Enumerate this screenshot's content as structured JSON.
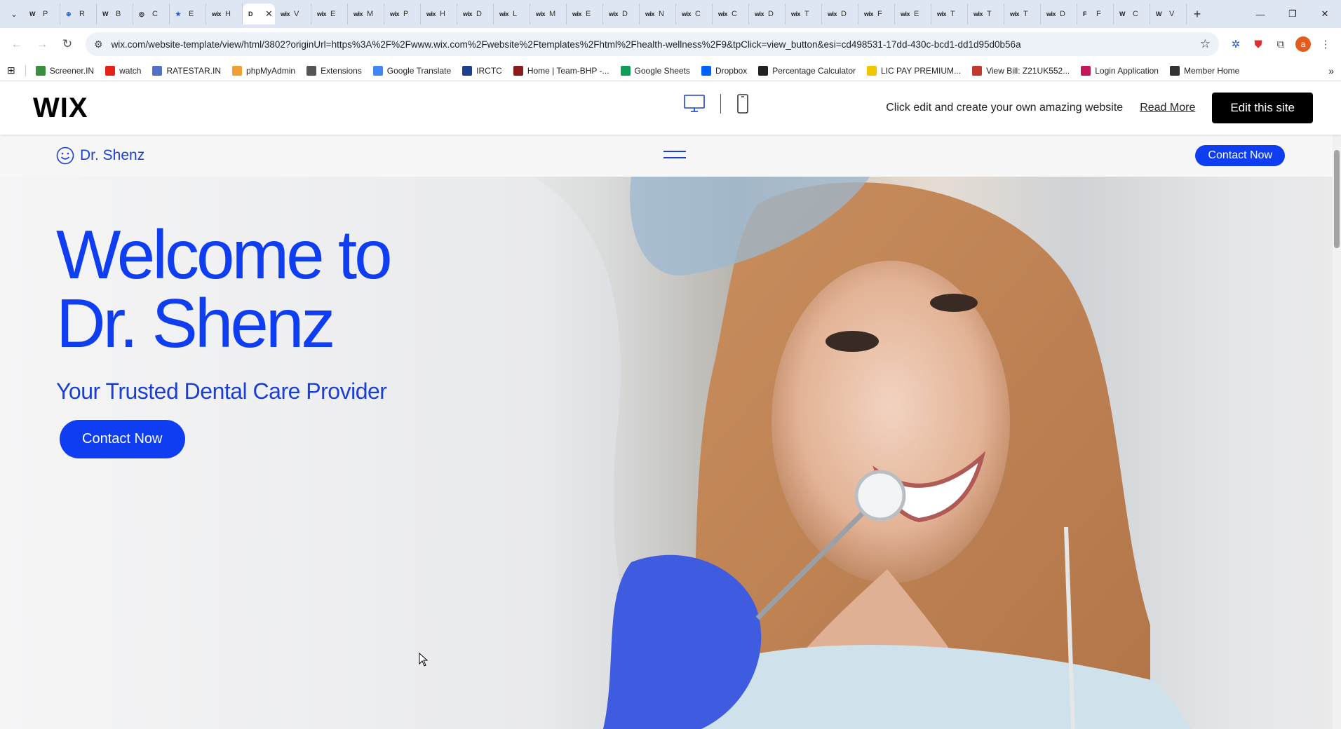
{
  "browser": {
    "tabs": [
      {
        "fav": "W",
        "label": "P"
      },
      {
        "fav": "⊕",
        "label": "R"
      },
      {
        "fav": "W",
        "label": "B"
      },
      {
        "fav": "◎",
        "label": "C"
      },
      {
        "fav": "★",
        "label": "E"
      },
      {
        "fav": "wix",
        "label": "H"
      },
      {
        "fav": "D",
        "label": "",
        "active": true
      },
      {
        "fav": "wix",
        "label": "V"
      },
      {
        "fav": "wix",
        "label": "E"
      },
      {
        "fav": "wix",
        "label": "M"
      },
      {
        "fav": "wix",
        "label": "P"
      },
      {
        "fav": "wix",
        "label": "H"
      },
      {
        "fav": "wix",
        "label": "D"
      },
      {
        "fav": "wix",
        "label": "L"
      },
      {
        "fav": "wix",
        "label": "M"
      },
      {
        "fav": "wix",
        "label": "E"
      },
      {
        "fav": "wix",
        "label": "D"
      },
      {
        "fav": "wix",
        "label": "N"
      },
      {
        "fav": "wix",
        "label": "C"
      },
      {
        "fav": "wix",
        "label": "C"
      },
      {
        "fav": "wix",
        "label": "D"
      },
      {
        "fav": "wix",
        "label": "T"
      },
      {
        "fav": "wix",
        "label": "D"
      },
      {
        "fav": "wix",
        "label": "F"
      },
      {
        "fav": "wix",
        "label": "E"
      },
      {
        "fav": "wix",
        "label": "T"
      },
      {
        "fav": "wix",
        "label": "T"
      },
      {
        "fav": "wix",
        "label": "T"
      },
      {
        "fav": "wix",
        "label": "D"
      },
      {
        "fav": "F",
        "label": "F"
      },
      {
        "fav": "W",
        "label": "C"
      },
      {
        "fav": "W",
        "label": "V"
      }
    ],
    "url": "wix.com/website-template/view/html/3802?originUrl=https%3A%2F%2Fwww.wix.com%2Fwebsite%2Ftemplates%2Fhtml%2Fhealth-wellness%2F9&tpClick=view_button&esi=cd498531-17dd-430c-bcd1-dd1d95d0b56a",
    "profile_initial": "a",
    "bookmarks": [
      {
        "label": "Screener.IN",
        "color": "#3a8f3a"
      },
      {
        "label": "watch",
        "color": "#e62117"
      },
      {
        "label": "RATESTAR.IN",
        "color": "#5470c6"
      },
      {
        "label": "phpMyAdmin",
        "color": "#f0a030"
      },
      {
        "label": "Extensions",
        "color": "#555555"
      },
      {
        "label": "Google Translate",
        "color": "#4285f4"
      },
      {
        "label": "IRCTC",
        "color": "#1f3f8c"
      },
      {
        "label": "Home | Team-BHP -...",
        "color": "#8b1a1a"
      },
      {
        "label": "Google Sheets",
        "color": "#0f9d58"
      },
      {
        "label": "Dropbox",
        "color": "#0061fe"
      },
      {
        "label": "Percentage Calculator",
        "color": "#222222"
      },
      {
        "label": "LIC PAY PREMIUM...",
        "color": "#f5c400"
      },
      {
        "label": "View Bill: Z21UK552...",
        "color": "#c0392b"
      },
      {
        "label": "Login Application",
        "color": "#c2185b"
      },
      {
        "label": "Member Home",
        "color": "#333333"
      }
    ]
  },
  "wix": {
    "logo": "WIX",
    "promo_text": "Click edit and create your own amazing website",
    "read_more": "Read More",
    "edit_button": "Edit this site"
  },
  "site": {
    "brand": "Dr. Shenz",
    "header_contact": "Contact Now",
    "hero_title_line1": "Welcome to",
    "hero_title_line2": "Dr. Shenz",
    "hero_subtitle": "Your Trusted Dental Care Provider",
    "hero_cta": "Contact Now"
  },
  "colors": {
    "brand_blue": "#0f3df2",
    "wix_black": "#000000"
  }
}
